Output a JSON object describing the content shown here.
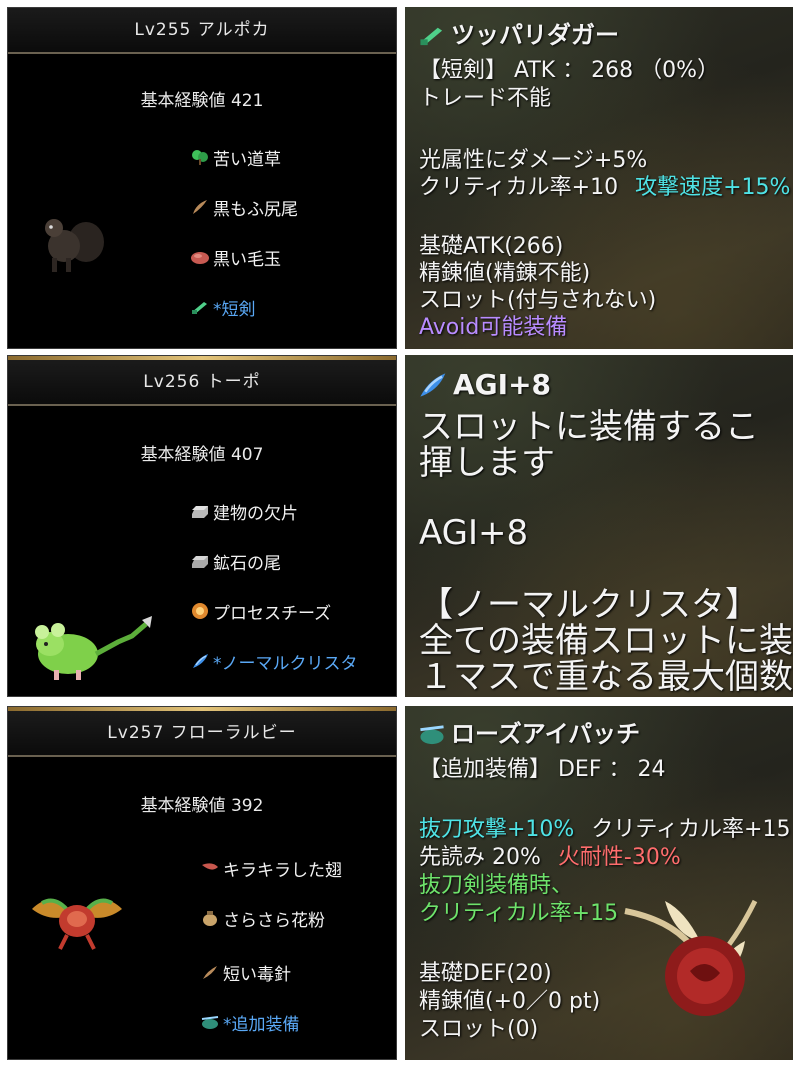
{
  "monsters": [
    {
      "title": "Lv255 アルポカ",
      "exp": "基本経験値 421",
      "drops": [
        {
          "icon": "herb-icon",
          "label": "苦い道草"
        },
        {
          "icon": "feather-icon",
          "label": "黒もふ尻尾"
        },
        {
          "icon": "fur-ball-icon",
          "label": "黒い毛玉"
        },
        {
          "icon": "dagger-icon",
          "label": "*短剣"
        }
      ]
    },
    {
      "title": "Lv256 トーポ",
      "exp": "基本経験値 407",
      "drops": [
        {
          "icon": "metal-ingot-icon",
          "label": "建物の欠片"
        },
        {
          "icon": "metal-ingot-icon",
          "label": "鉱石の尾"
        },
        {
          "icon": "cheese-icon",
          "label": "プロセスチーズ"
        },
        {
          "icon": "crystal-icon",
          "label": "*ノーマルクリスタ"
        }
      ]
    },
    {
      "title": "Lv257 フローラルビー",
      "exp": "基本経験値 392",
      "drops": [
        {
          "icon": "wing-icon",
          "label": "キラキラした翅"
        },
        {
          "icon": "pollen-bag-icon",
          "label": "さらさら花粉"
        },
        {
          "icon": "needle-icon",
          "label": "短い毒針"
        },
        {
          "icon": "eyepatch-icon",
          "label": "*追加装備"
        }
      ]
    }
  ],
  "items": [
    {
      "name": "ツッパリダガー",
      "lines": [
        "【短剣】 ATK ： 268 （0%）",
        "トレード不能",
        "光属性にダメージ+5%",
        "クリティカル率+10",
        "攻撃速度+15%",
        "基礎ATK(266)",
        "精錬値(精錬不能)",
        "スロット(付与されない)",
        "Avoid可能装備"
      ]
    },
    {
      "name": "AGI+8",
      "lines": [
        "スロットに装備するこ",
        "揮します",
        "AGI+8",
        "【ノーマルクリスタ】",
        "全ての装備スロットに装",
        "１マスで重なる最大個数"
      ]
    },
    {
      "name": "ローズアイパッチ",
      "lines": [
        "【追加装備】 DEF ： 24",
        "抜刀攻撃+10%",
        "クリティカル率+15",
        "先読み 20%",
        "火耐性-30%",
        "抜刀剣装備時、",
        "クリティカル率+15",
        "基礎DEF(20)",
        "精錬値(+0／0 pt)",
        "スロット(0)"
      ]
    }
  ],
  "colors": {
    "stat_cyan": "#4fe3e6",
    "avoid_purple": "#b98cff",
    "penalty_red": "#ff6d6d",
    "bonus_green": "#6ee36b",
    "drop_blue": "#5aa8f5"
  }
}
